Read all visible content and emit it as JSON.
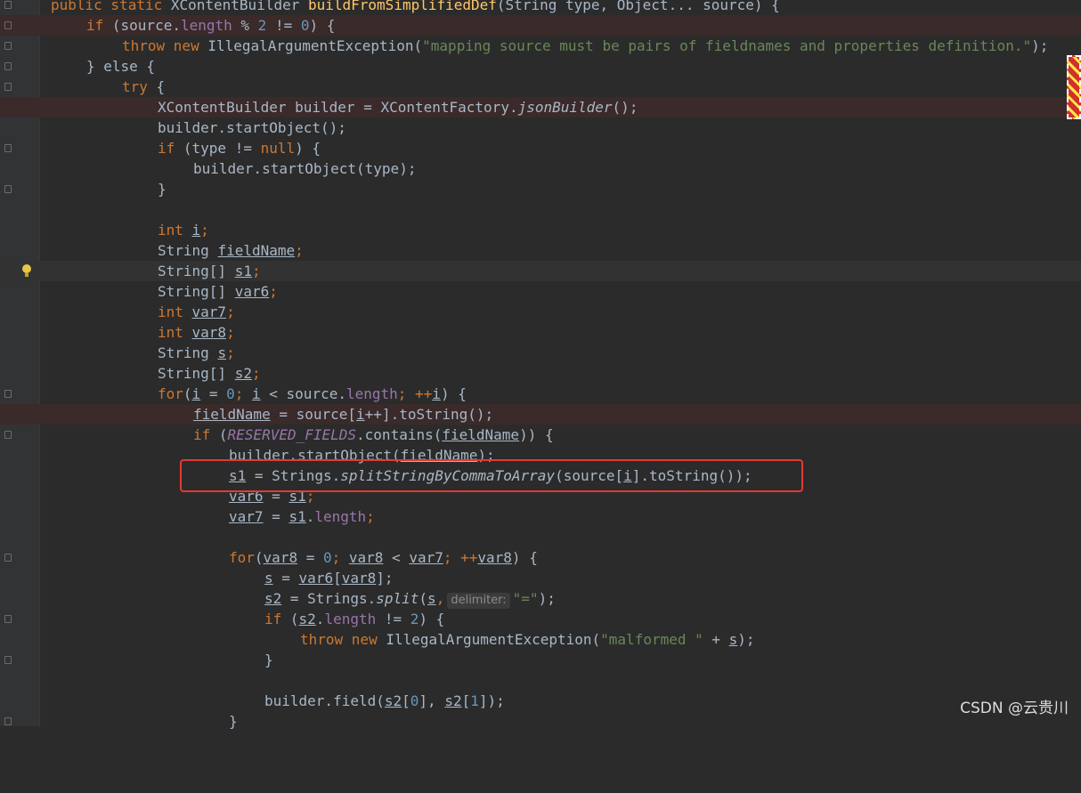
{
  "hint_label": "delimiter:",
  "watermark": "CSDN @云贵川",
  "code": {
    "l0_public_static": "public static ",
    "l0_type": "XContentBuilder ",
    "l0_method": "buildFromSimplifiedDef",
    "l0_params": "(String type, Object... source) {",
    "l1_if": "if",
    "l1_source": " (source.",
    "l1_length": "length",
    "l1_mod": " % ",
    "l1_two": "2",
    "l1_neq": " != ",
    "l1_zero": "0",
    "l1_end": ") {",
    "l2_throw_new": "throw new ",
    "l2_exception": "IllegalArgumentException(",
    "l2_message": "\"mapping source must be pairs of fieldnames and properties definition.\"",
    "l2_end": ");",
    "l3_else": "} else {",
    "l4_try": "try",
    "l4_brace": " {",
    "l5_decl": "XContentBuilder builder = XContentFactory.",
    "l5_method": "jsonBuilder",
    "l5_end": "();",
    "l6": "builder.startObject();",
    "l7_if": "if",
    "l7_cond": " (type != ",
    "l7_null": "null",
    "l7_end": ") {",
    "l8": "builder.startObject(type);",
    "l9": "}",
    "l11_int": "int ",
    "l11_var": "i",
    "semi": ";",
    "l12_type": "String ",
    "l12_var": "fieldName",
    "l13_type": "String[] ",
    "l13_var": "s1",
    "l14_type": "String[] ",
    "l14_var": "var6",
    "l15_int": "int ",
    "l15_var": "var7",
    "l16_int": "int ",
    "l16_var": "var8",
    "l17_type": "String ",
    "l17_var": "s",
    "l18_type": "String[] ",
    "l18_var": "s2",
    "l19_for": "for",
    "l19_open": "(",
    "l19_i": "i",
    "l19_assign": " = ",
    "l19_zero": "0",
    "l19_sc": "; ",
    "l19_i2": "i",
    "l19_lt": " < source.",
    "l19_length": "length",
    "l19_sc2": "; ++",
    "l19_i3": "i",
    "l19_end": ") {",
    "l20_var": "fieldName",
    "l20_mid": " = source[",
    "l20_i": "i",
    "l20_end": "++].toString();",
    "l21_if": "if",
    "l21_open": " (",
    "l21_const": "RESERVED_FIELDS",
    "l21_contains": ".contains(",
    "l21_var": "fieldName",
    "l21_end": ")) {",
    "l22_pre": "builder.startObject(",
    "l22_var": "fieldName",
    "l22_end": ");",
    "l23_var": "s1",
    "l23_mid": " = Strings.",
    "l23_method": "splitStringByCommaToArray",
    "l23_src": "(source[",
    "l23_i": "i",
    "l23_end": "].toString());",
    "l24_var": "var6",
    "l24_mid": " = ",
    "l24_rhs": "s1",
    "l25_var": "var7",
    "l25_mid": " = ",
    "l25_rhs": "s1",
    "l25_dot": ".",
    "l25_length": "length",
    "l27_for": "for",
    "l27_open": "(",
    "l27_v1": "var8",
    "l27_assign": " = ",
    "l27_zero": "0",
    "l27_sc": "; ",
    "l27_v2": "var8",
    "l27_lt": " < ",
    "l27_v3": "var7",
    "l27_sc2": "; ++",
    "l27_v4": "var8",
    "l27_end": ") {",
    "l28_var": "s",
    "l28_mid": " = ",
    "l28_arr": "var6",
    "l28_br": "[",
    "l28_idx": "var8",
    "l28_end": "];",
    "l29_var": "s2",
    "l29_mid": " = Strings.",
    "l29_method": "split",
    "l29_open": "(",
    "l29_arg": "s",
    "l29_comma": ",",
    "l29_str": "\"=\"",
    "l29_end": ");",
    "l30_if": "if",
    "l30_open": " (",
    "l30_var": "s2",
    "l30_dot": ".",
    "l30_length": "length",
    "l30_neq": " != ",
    "l30_two": "2",
    "l30_end": ") {",
    "l31_throw_new": "throw new ",
    "l31_exception": "IllegalArgumentException(",
    "l31_str": "\"malformed \"",
    "l31_plus": " + ",
    "l31_var": "s",
    "l31_end": ");",
    "l32": "}",
    "l34_pre": "builder.field(",
    "l34_v1": "s2",
    "l34_br1": "[",
    "l34_zero": "0",
    "l34_br1e": "], ",
    "l34_v2": "s2",
    "l34_br2": "[",
    "l34_one": "1",
    "l34_end": "]);",
    "l35": "}"
  }
}
